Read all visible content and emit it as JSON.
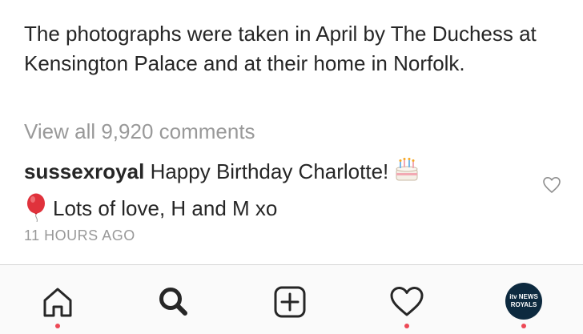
{
  "post": {
    "caption": "The photographs were taken in April by The Duchess at Kensington Palace and at their home in Norfolk.",
    "view_all_comments": "View all 9,920 comments",
    "comment": {
      "username": "sussexroyal",
      "text_line1": "Happy Birthday Charlotte!",
      "text_line2": "Lots of love, H and M xo",
      "emojis": [
        "birthday-cake-icon",
        "balloon-icon"
      ]
    },
    "timestamp": "11 HOURS AGO"
  },
  "nav": {
    "items": [
      "home-icon",
      "search-icon",
      "new-post-icon",
      "activity-heart-icon",
      "profile-avatar"
    ],
    "avatar_text": {
      "line1": "itv NEWS",
      "line2": "ROYALS"
    },
    "notification_dot_color": "#ed4956"
  },
  "colors": {
    "text": "#262626",
    "secondary": "#999999",
    "nav_background": "#fafafa",
    "balloon": "#e0323c"
  }
}
